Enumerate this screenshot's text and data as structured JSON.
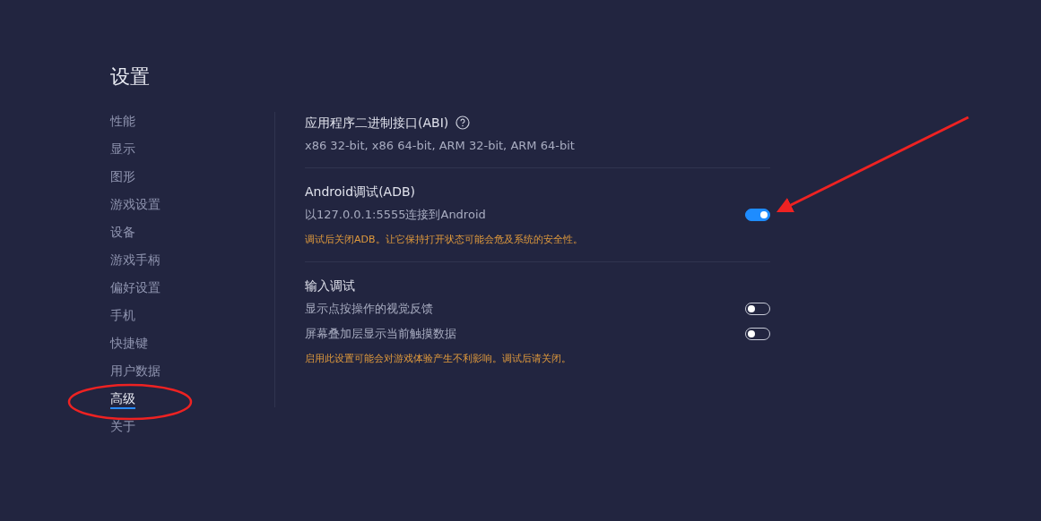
{
  "title": "设置",
  "sidebar": {
    "items": [
      {
        "label": "性能",
        "selected": false
      },
      {
        "label": "显示",
        "selected": false
      },
      {
        "label": "图形",
        "selected": false
      },
      {
        "label": "游戏设置",
        "selected": false
      },
      {
        "label": "设备",
        "selected": false
      },
      {
        "label": "游戏手柄",
        "selected": false
      },
      {
        "label": "偏好设置",
        "selected": false
      },
      {
        "label": "手机",
        "selected": false
      },
      {
        "label": "快捷键",
        "selected": false
      },
      {
        "label": "用户数据",
        "selected": false
      },
      {
        "label": "高级",
        "selected": true
      },
      {
        "label": "关于",
        "selected": false
      }
    ]
  },
  "sections": [
    {
      "title": "应用程序二进制接口(ABI)",
      "help": true,
      "rows": [
        {
          "kind": "text",
          "text": "x86 32-bit, x86 64-bit, ARM 32-bit, ARM 64-bit"
        }
      ]
    },
    {
      "title": "Android调试(ADB)",
      "help": false,
      "rows": [
        {
          "kind": "toggle",
          "label": "以127.0.0.1:5555连接到Android",
          "on": true
        },
        {
          "kind": "warning",
          "text": "调试后关闭ADB。让它保持打开状态可能会危及系统的安全性。"
        }
      ]
    },
    {
      "title": "输入调试",
      "help": false,
      "rows": [
        {
          "kind": "toggle",
          "label": "显示点按操作的视觉反馈",
          "on": false
        },
        {
          "kind": "toggle",
          "label": "屏幕叠加层显示当前触摸数据",
          "on": false
        },
        {
          "kind": "warning",
          "text": "启用此设置可能会对游戏体验产生不利影响。调试后请关闭。"
        }
      ]
    }
  ]
}
